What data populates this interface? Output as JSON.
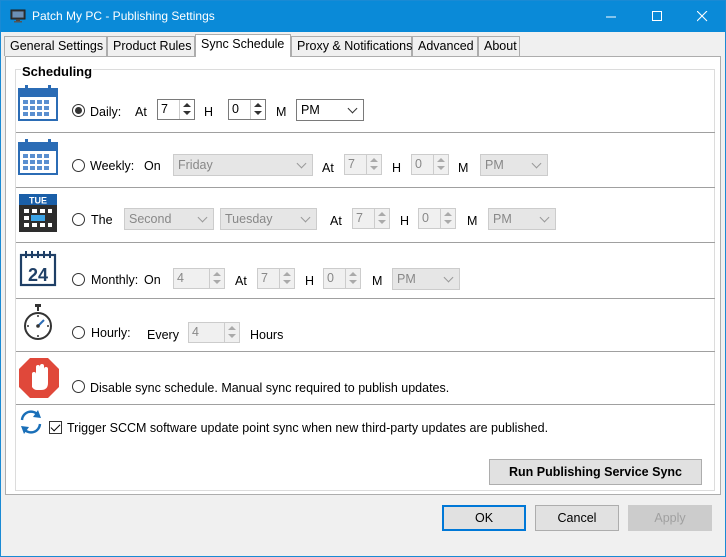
{
  "window": {
    "title": "Patch My PC - Publishing Settings"
  },
  "titlebar_controls": {
    "minimize": "—",
    "close": "✕"
  },
  "tabs": [
    {
      "label": "General Settings",
      "active": false
    },
    {
      "label": "Product Rules",
      "active": false
    },
    {
      "label": "Sync Schedule",
      "active": true
    },
    {
      "label": "Proxy & Notifications",
      "active": false
    },
    {
      "label": "Advanced",
      "active": false
    },
    {
      "label": "About",
      "active": false
    }
  ],
  "scheduling": {
    "title": "Scheduling",
    "daily": {
      "label": "Daily:",
      "selected": true,
      "at_label": "At",
      "hour": "7",
      "h_label": "H",
      "minute": "0",
      "m_label": "M",
      "ampm": "PM"
    },
    "weekly": {
      "label": "Weekly:",
      "selected": false,
      "on_label": "On",
      "day": "Friday",
      "at_label": "At",
      "hour": "7",
      "h_label": "H",
      "minute": "0",
      "m_label": "M",
      "ampm": "PM"
    },
    "the": {
      "label": "The",
      "selected": false,
      "occurrence": "Second",
      "day": "Tuesday",
      "at_label": "At",
      "hour": "7",
      "h_label": "H",
      "minute": "0",
      "m_label": "M",
      "ampm": "PM",
      "icon_text": "TUE"
    },
    "monthly": {
      "label": "Monthly:",
      "selected": false,
      "on_label": "On",
      "day": "4",
      "at_label": "At",
      "hour": "7",
      "h_label": "H",
      "minute": "0",
      "m_label": "M",
      "ampm": "PM",
      "icon_text": "24"
    },
    "hourly": {
      "label": "Hourly:",
      "selected": false,
      "every_label": "Every",
      "hours": "4",
      "hours_label": "Hours"
    },
    "disable": {
      "label": "Disable sync schedule. Manual sync required to publish updates.",
      "selected": false
    },
    "trigger": {
      "label": "Trigger SCCM software update point sync when new third-party updates are published.",
      "checked": true
    },
    "run_button": "Run Publishing Service Sync"
  },
  "footer": {
    "ok": "OK",
    "cancel": "Cancel",
    "apply": "Apply"
  },
  "colors": {
    "titlebar": "#0a8ad8",
    "calendar_blue": "#2b6cb5",
    "stop_red": "#e0483a",
    "default_button_border": "#0078d7"
  }
}
